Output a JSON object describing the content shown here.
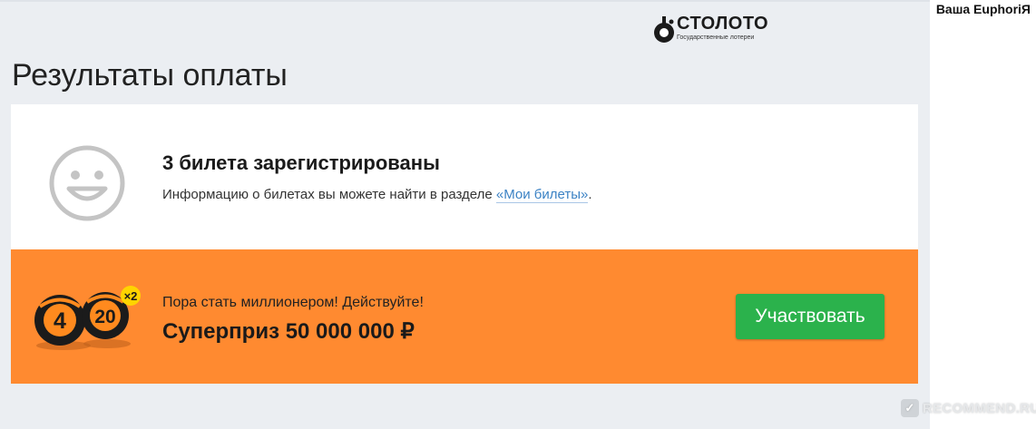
{
  "watermark": {
    "top_text": "Ваша EuphoriЯ",
    "bottom_text": "RECOMMEND.RU"
  },
  "logo": {
    "word": "СТОЛОТО",
    "subtitle": "Государственные лотереи"
  },
  "page": {
    "title": "Результаты оплаты"
  },
  "result_card": {
    "title": "3 билета зарегистрированы",
    "info_text": "Информацию о билетах вы можете найти в разделе ",
    "link_text": "«Мои билеты»",
    "info_end": "."
  },
  "promo": {
    "ball1": "4",
    "ball2": "20",
    "multiplier": "×2",
    "subtitle": "Пора стать миллионером! Действуйте!",
    "headline": "Суперприз 50 000 000 ₽",
    "button_label": "Участвовать"
  },
  "colors": {
    "page_bg": "#ebeef2",
    "promo_bg": "#ff8a30",
    "cta_bg": "#2bb24c",
    "link": "#3b82c4"
  }
}
